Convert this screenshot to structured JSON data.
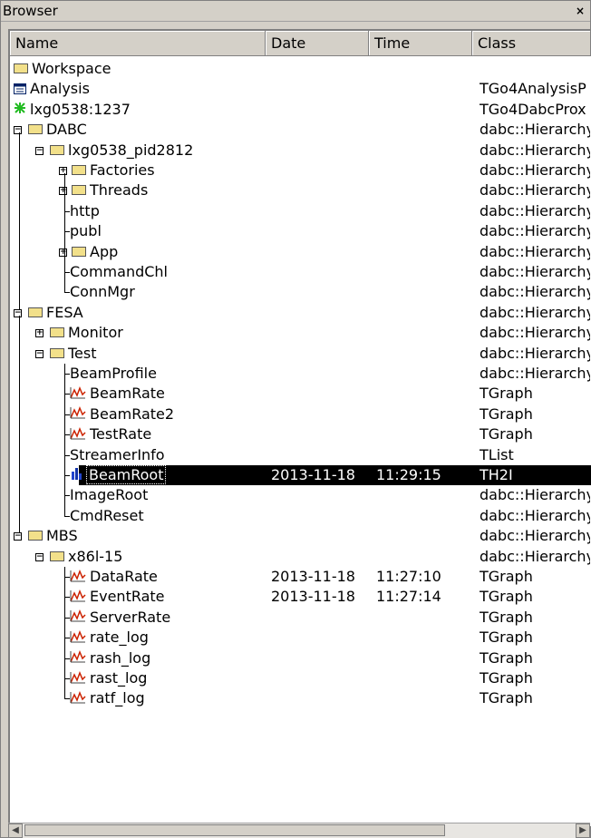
{
  "window": {
    "title": "Browser",
    "close_glyph": "×"
  },
  "columns": [
    "Name",
    "Date",
    "Time",
    "Class"
  ],
  "rows": [
    {
      "name": "Workspace",
      "icon": "folder-icon",
      "date": "",
      "time": "",
      "cls": "",
      "depth": 0
    },
    {
      "name": "Analysis",
      "icon": "analysis-icon",
      "date": "",
      "time": "",
      "cls": "TGo4AnalysisP",
      "depth": 0
    },
    {
      "name": "lxg0538:1237",
      "icon": "dabc-server-icon",
      "date": "",
      "time": "",
      "cls": "TGo4DabcProx",
      "depth": 0
    },
    {
      "name": "DABC",
      "icon": "folder-icon",
      "date": "",
      "time": "",
      "cls": "dabc::Hierarchy",
      "depth": 0
    },
    {
      "name": "lxg0538_pid2812",
      "icon": "folder-icon",
      "date": "",
      "time": "",
      "cls": "dabc::Hierarchy",
      "depth": 1
    },
    {
      "name": "Factories",
      "icon": "folder-icon",
      "date": "",
      "time": "",
      "cls": "dabc::Hierarchy",
      "depth": 2
    },
    {
      "name": "Threads",
      "icon": "folder-icon",
      "date": "",
      "time": "",
      "cls": "dabc::Hierarchy",
      "depth": 2
    },
    {
      "name": "http",
      "icon": "",
      "date": "",
      "time": "",
      "cls": "dabc::Hierarchy",
      "depth": 2
    },
    {
      "name": "publ",
      "icon": "",
      "date": "",
      "time": "",
      "cls": "dabc::Hierarchy",
      "depth": 2
    },
    {
      "name": "App",
      "icon": "folder-icon",
      "date": "",
      "time": "",
      "cls": "dabc::Hierarchy",
      "depth": 2
    },
    {
      "name": "CommandChl",
      "icon": "",
      "date": "",
      "time": "",
      "cls": "dabc::Hierarchy",
      "depth": 2
    },
    {
      "name": "ConnMgr",
      "icon": "",
      "date": "",
      "time": "",
      "cls": "dabc::Hierarchy",
      "depth": 2
    },
    {
      "name": "FESA",
      "icon": "folder-icon",
      "date": "",
      "time": "",
      "cls": "dabc::Hierarchy",
      "depth": 0
    },
    {
      "name": "Monitor",
      "icon": "folder-icon",
      "date": "",
      "time": "",
      "cls": "dabc::Hierarchy",
      "depth": 1
    },
    {
      "name": "Test",
      "icon": "folder-icon",
      "date": "",
      "time": "",
      "cls": "dabc::Hierarchy",
      "depth": 1
    },
    {
      "name": "BeamProfile",
      "icon": "",
      "date": "",
      "time": "",
      "cls": "dabc::Hierarchy",
      "depth": 2
    },
    {
      "name": "BeamRate",
      "icon": "graph-icon",
      "date": "",
      "time": "",
      "cls": "TGraph",
      "depth": 2
    },
    {
      "name": "BeamRate2",
      "icon": "graph-icon",
      "date": "",
      "time": "",
      "cls": "TGraph",
      "depth": 2
    },
    {
      "name": "TestRate",
      "icon": "graph-icon",
      "date": "",
      "time": "",
      "cls": "TGraph",
      "depth": 2
    },
    {
      "name": "StreamerInfo",
      "icon": "",
      "date": "",
      "time": "",
      "cls": "TList",
      "depth": 2
    },
    {
      "name": "BeamRoot",
      "icon": "histogram-2d-icon",
      "date": "2013-11-18",
      "time": "11:29:15",
      "cls": "TH2I",
      "depth": 2,
      "selected": true
    },
    {
      "name": "ImageRoot",
      "icon": "",
      "date": "",
      "time": "",
      "cls": "dabc::Hierarchy",
      "depth": 2
    },
    {
      "name": "CmdReset",
      "icon": "",
      "date": "",
      "time": "",
      "cls": "dabc::Hierarchy",
      "depth": 2
    },
    {
      "name": "MBS",
      "icon": "folder-icon",
      "date": "",
      "time": "",
      "cls": "dabc::Hierarchy",
      "depth": 0
    },
    {
      "name": "x86l-15",
      "icon": "folder-icon",
      "date": "",
      "time": "",
      "cls": "dabc::Hierarchy",
      "depth": 1
    },
    {
      "name": "DataRate",
      "icon": "graph-icon",
      "date": "2013-11-18",
      "time": "11:27:10",
      "cls": "TGraph",
      "depth": 2
    },
    {
      "name": "EventRate",
      "icon": "graph-icon",
      "date": "2013-11-18",
      "time": "11:27:14",
      "cls": "TGraph",
      "depth": 2
    },
    {
      "name": "ServerRate",
      "icon": "graph-icon",
      "date": "",
      "time": "",
      "cls": "TGraph",
      "depth": 2
    },
    {
      "name": "rate_log",
      "icon": "graph-icon",
      "date": "",
      "time": "",
      "cls": "TGraph",
      "depth": 2
    },
    {
      "name": "rash_log",
      "icon": "graph-icon",
      "date": "",
      "time": "",
      "cls": "TGraph",
      "depth": 2
    },
    {
      "name": "rast_log",
      "icon": "graph-icon",
      "date": "",
      "time": "",
      "cls": "TGraph",
      "depth": 2
    },
    {
      "name": "ratf_log",
      "icon": "graph-icon",
      "date": "",
      "time": "",
      "cls": "TGraph",
      "depth": 2
    }
  ],
  "colors": {
    "selection": "#000000",
    "folder": "#f2e08a",
    "graph": "#cc2200",
    "server": "#22bb22"
  }
}
